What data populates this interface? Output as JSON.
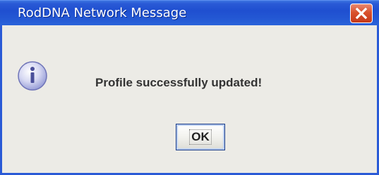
{
  "window": {
    "title": "RodDNA Network Message"
  },
  "dialog": {
    "message": "Profile successfully updated!",
    "icon": "info-icon",
    "ok_label": "OK"
  },
  "colors": {
    "titlebar": "#2a5ad6",
    "close_button": "#d9512d",
    "dialog_background": "#ecebe6"
  }
}
